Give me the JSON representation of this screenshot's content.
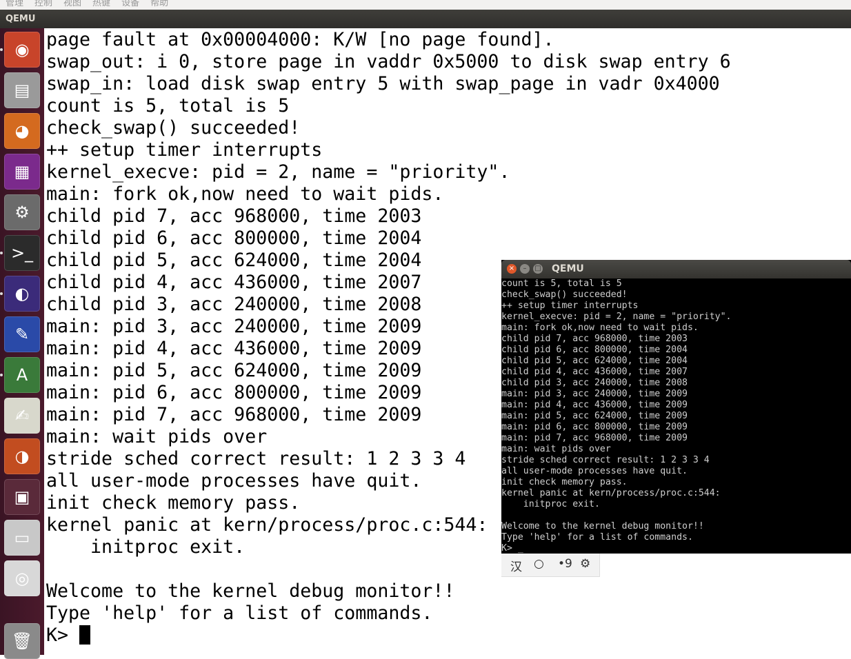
{
  "menu": {
    "items": [
      "管理",
      "控制",
      "视图",
      "热键",
      "设备",
      "帮助"
    ]
  },
  "window": {
    "title": "QEMU"
  },
  "launcher": {
    "items": [
      {
        "name": "ubuntu-dash-icon",
        "glyph": "◉",
        "bg": "#c8442a"
      },
      {
        "name": "files-icon",
        "glyph": "▤",
        "bg": "#9a9a9a"
      },
      {
        "name": "firefox-icon",
        "glyph": "◕",
        "bg": "#d46a1f"
      },
      {
        "name": "software-icon",
        "glyph": "▦",
        "bg": "#7b2a8c"
      },
      {
        "name": "settings-icon",
        "glyph": "⚙",
        "bg": "#6b6b6b"
      },
      {
        "name": "terminal-icon",
        "glyph": ">_",
        "bg": "#2b2b2b"
      },
      {
        "name": "eclipse-icon",
        "glyph": "◐",
        "bg": "#3b2b7a"
      },
      {
        "name": "editor-icon",
        "glyph": "✎",
        "bg": "#2a4aa8"
      },
      {
        "name": "updater-icon",
        "glyph": "A",
        "bg": "#3a7a3a"
      },
      {
        "name": "text-editor-icon",
        "glyph": "✍",
        "bg": "#d8d8cc"
      },
      {
        "name": "app-icon",
        "glyph": "◑",
        "bg": "#c24d20"
      },
      {
        "name": "workspace-icon",
        "glyph": "▣",
        "bg": "#5a2a3a"
      },
      {
        "name": "disk-icon",
        "glyph": "▭",
        "bg": "#c8c8c8"
      },
      {
        "name": "cdrom-icon",
        "glyph": "◎",
        "bg": "#d8d8d8"
      },
      {
        "name": "trash-icon",
        "glyph": "🗑",
        "bg": "#8a8a8a"
      }
    ]
  },
  "terminal": {
    "lines": [
      "page fault at 0x00004000: K/W [no page found].",
      "swap_out: i 0, store page in vaddr 0x5000 to disk swap entry 6",
      "swap_in: load disk swap entry 5 with swap_page in vadr 0x4000",
      "count is 5, total is 5",
      "check_swap() succeeded!",
      "++ setup timer interrupts",
      "kernel_execve: pid = 2, name = \"priority\".",
      "main: fork ok,now need to wait pids.",
      "child pid 7, acc 968000, time 2003",
      "child pid 6, acc 800000, time 2004",
      "child pid 5, acc 624000, time 2004",
      "child pid 4, acc 436000, time 2007",
      "child pid 3, acc 240000, time 2008",
      "main: pid 3, acc 240000, time 2009",
      "main: pid 4, acc 436000, time 2009",
      "main: pid 5, acc 624000, time 2009",
      "main: pid 6, acc 800000, time 2009",
      "main: pid 7, acc 968000, time 2009",
      "main: wait pids over",
      "stride sched correct result: 1 2 3 3 4",
      "all user-mode processes have quit.",
      "init check memory pass.",
      "kernel panic at kern/process/proc.c:544:",
      "    initproc exit.",
      "",
      "Welcome to the kernel debug monitor!!",
      "Type 'help' for a list of commands."
    ],
    "prompt": "K> "
  },
  "qemu_small": {
    "title": "QEMU",
    "lines": [
      "count is 5, total is 5",
      "check_swap() succeeded!",
      "++ setup timer interrupts",
      "kernel_execve: pid = 2, name = \"priority\".",
      "main: fork ok,now need to wait pids.",
      "child pid 7, acc 968000, time 2003",
      "child pid 6, acc 800000, time 2004",
      "child pid 5, acc 624000, time 2004",
      "child pid 4, acc 436000, time 2007",
      "child pid 3, acc 240000, time 2008",
      "main: pid 3, acc 240000, time 2009",
      "main: pid 4, acc 436000, time 2009",
      "main: pid 5, acc 624000, time 2009",
      "main: pid 6, acc 800000, time 2009",
      "main: pid 7, acc 968000, time 2009",
      "main: wait pids over",
      "stride sched correct result: 1 2 3 3 4",
      "all user-mode processes have quit.",
      "init check memory pass.",
      "kernel panic at kern/process/proc.c:544:",
      "    initproc exit.",
      "",
      "Welcome to the kernel debug monitor!!",
      "Type 'help' for a list of commands.",
      "K> _"
    ]
  },
  "ime": {
    "lang": "汉",
    "mode": "○",
    "punct": "•9",
    "settings": "⚙"
  }
}
